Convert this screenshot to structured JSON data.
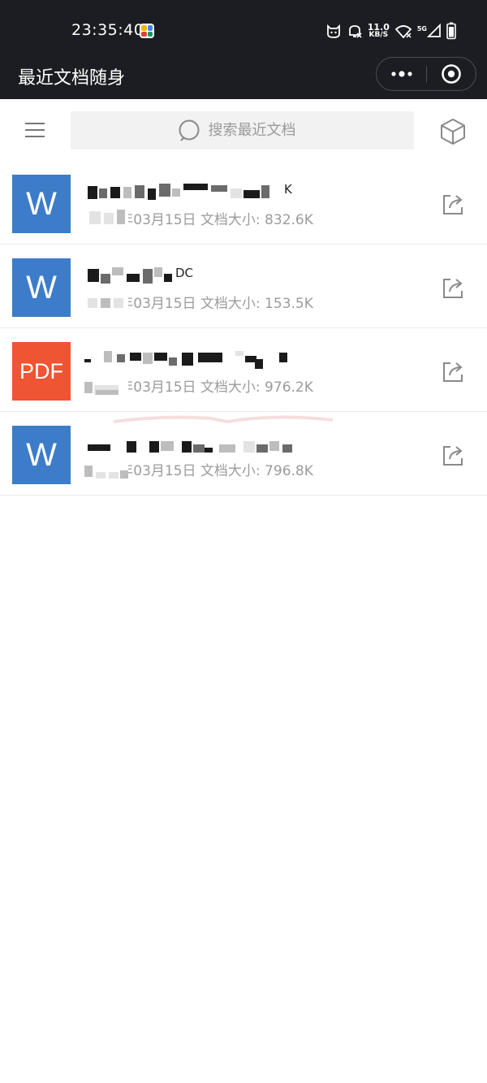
{
  "status_bar": {
    "time": "23:35:40",
    "net_speed_value": "11.0",
    "net_speed_unit": "KB/S",
    "signal_label": "5G",
    "app_badge_colors": [
      "#f4b400",
      "#4285f4",
      "#db4437",
      "#0f9d58"
    ]
  },
  "nav": {
    "title": "最近文档随身"
  },
  "toolbar": {
    "search_placeholder": "搜索最近文档"
  },
  "documents": [
    {
      "type": "word",
      "icon_label": "W",
      "name_visible": "K",
      "meta": "2023年03月15日  文档大小: 832.6K"
    },
    {
      "type": "word",
      "icon_label": "W",
      "name_visible": "DC",
      "meta": "2023年03月15日  文档大小: 153.5K"
    },
    {
      "type": "pdf",
      "icon_label": "PDF",
      "name_visible": "",
      "meta": "2023年03月15日  文档大小: 976.2K"
    },
    {
      "type": "word",
      "icon_label": "W",
      "name_visible": "",
      "meta": "2023年03月15日  文档大小: 796.8K"
    }
  ],
  "colors": {
    "status_nav_bg": "#1b1d22",
    "word_icon": "#3c7cc9",
    "pdf_icon": "#ef5433",
    "meta_text": "#9b9b9b",
    "search_bg": "#f2f2f2"
  }
}
